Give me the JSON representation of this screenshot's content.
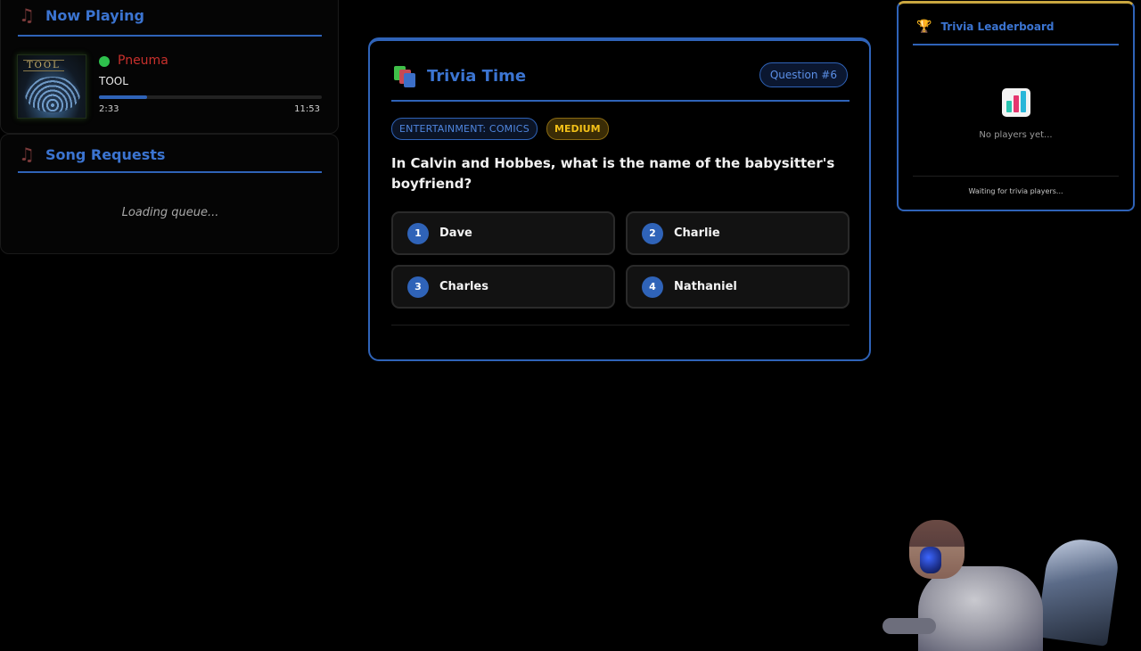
{
  "now_playing": {
    "title": "Now Playing",
    "icon": "music-note-icon",
    "album_logo": "TOOL",
    "song": "Pneuma",
    "artist": "TOOL",
    "elapsed": "2:33",
    "duration": "11:53",
    "progress_fraction": 0.215,
    "status_color": "#2ec14d"
  },
  "song_requests": {
    "title": "Song Requests",
    "icon": "music-note-icon",
    "loading_text": "Loading queue..."
  },
  "trivia": {
    "title": "Trivia Time",
    "icon": "books-icon",
    "question_badge": "Question #6",
    "category": "ENTERTAINMENT: COMICS",
    "difficulty": "MEDIUM",
    "question": "In Calvin and Hobbes, what is the name of the babysitter's boyfriend?",
    "answers": [
      {
        "num": "1",
        "text": "Dave"
      },
      {
        "num": "2",
        "text": "Charlie"
      },
      {
        "num": "3",
        "text": "Charles"
      },
      {
        "num": "4",
        "text": "Nathaniel"
      }
    ]
  },
  "leaderboard": {
    "title": "Trivia Leaderboard",
    "icon": "trophy-icon",
    "empty_text": "No players yet...",
    "waiting_text": "Waiting for trivia players..."
  },
  "colors": {
    "accent": "#2f63b8",
    "title_blue": "#3b74d1",
    "song_red": "#c9302c",
    "difficulty_gold": "#f2c018"
  }
}
